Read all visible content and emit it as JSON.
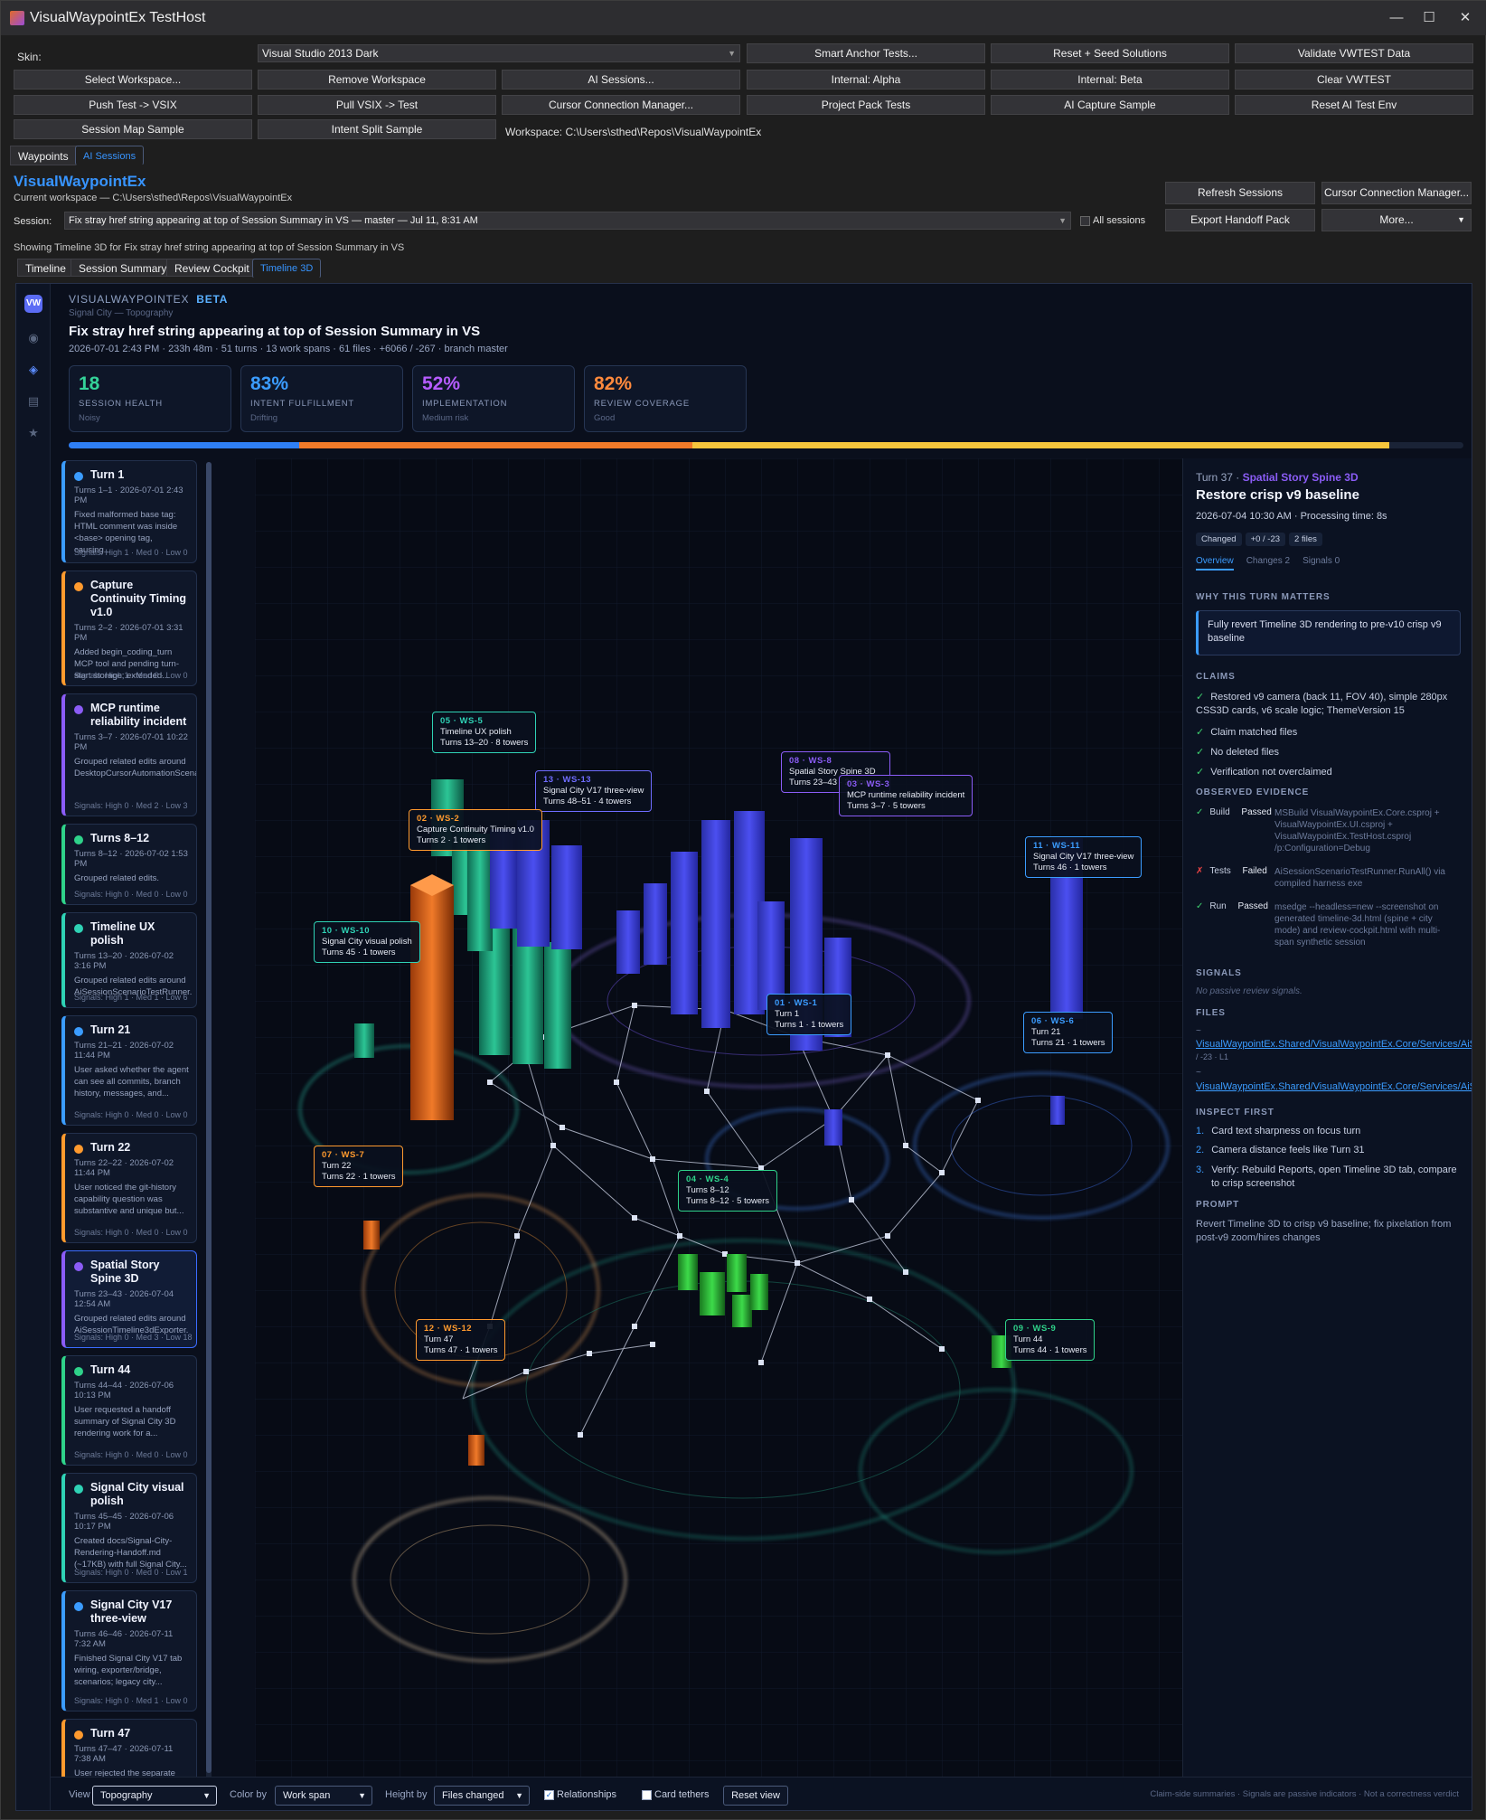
{
  "window": {
    "title": "VisualWaypointEx TestHost",
    "controls": [
      "—",
      "☐",
      "✕"
    ]
  },
  "toolbar": {
    "skin_label": "Skin:",
    "skin_value": "Visual Studio 2013 Dark",
    "buttons": [
      "Smart Anchor Tests...",
      "Reset + Seed Solutions",
      "Validate VWTEST Data",
      "Select Workspace...",
      "Remove Workspace",
      "AI Sessions...",
      "Internal: Alpha",
      "Internal: Beta",
      "Clear VWTEST",
      "Push Test -> VSIX",
      "Pull VSIX -> Test",
      "Cursor Connection Manager...",
      "Project Pack Tests",
      "AI Capture Sample",
      "Reset AI Test Env",
      "Session Map Sample",
      "Intent Split Sample"
    ],
    "workspace_text": "Workspace: C:\\Users\\sthed\\Repos\\VisualWaypointEx"
  },
  "outer_tabs": [
    "Waypoints",
    "AI Sessions"
  ],
  "header": {
    "title": "VisualWaypointEx",
    "workspace": "Current workspace — C:\\Users\\sthed\\Repos\\VisualWaypointEx",
    "session_label": "Session:",
    "session_value": "Fix stray href string appearing at top of Session Summary in VS — master — Jul 11, 8:31 AM",
    "all_sessions": "All sessions",
    "buttons": [
      "Refresh Sessions",
      "Cursor Connection Manager...",
      "Export Handoff Pack",
      "More..."
    ],
    "showing": "Showing Timeline 3D for Fix stray href string appearing at top of Session Summary in VS"
  },
  "inner_tabs": [
    "Timeline",
    "Session Summary",
    "Review Cockpit",
    "Timeline 3D"
  ],
  "report": {
    "rail_icons": [
      "vw-logo-icon",
      "target-icon",
      "diamond-icon",
      "list-icon",
      "star-icon"
    ],
    "logo_text": "VW",
    "brand": "VISUALWAYPOINTEX",
    "beta": "BETA",
    "subtitle": "Signal City — Topography",
    "title": "Fix stray href string appearing at top of Session Summary in VS",
    "meta": "2026-07-01 2:43 PM · 233h 48m · 51 turns · 13 work spans · 61 files · +6066 / -267 · branch master",
    "kpis": [
      {
        "value": "18",
        "label": "SESSION HEALTH",
        "sub": "Noisy",
        "color": "#34d399"
      },
      {
        "value": "83%",
        "label": "INTENT FULFILLMENT",
        "sub": "Drifting",
        "color": "#3b9cff"
      },
      {
        "value": "52%",
        "label": "IMPLEMENTATION",
        "sub": "Medium risk",
        "color": "#b65cff"
      },
      {
        "value": "82%",
        "label": "REVIEW COVERAGE",
        "sub": "Good",
        "color": "#ff8a3d"
      }
    ],
    "progress_segments": [
      {
        "fraction": 0.165,
        "color": "#2f7ff5"
      },
      {
        "fraction": 0.282,
        "color": "#f07a29"
      },
      {
        "fraction": 0.5,
        "color": "#f6c53c"
      }
    ]
  },
  "turn_cards": [
    {
      "title": "Turn 1",
      "meta": "Turns 1–1 · 2026-07-01 2:43 PM",
      "desc": "Fixed malformed base tag: HTML comment was inside <base> opening tag, causing...",
      "signals": "Signals: High 1 · Med 0 · Low 0",
      "color": "#3b9cff"
    },
    {
      "title": "Capture Continuity Timing v1.0",
      "meta": "Turns 2–2 · 2026-07-01 3:31 PM",
      "desc": "Added begin_coding_turn MCP tool and pending turn-start storage; extended...",
      "signals": "Signals: High 1 · Med 0 · Low 0",
      "color": "#ff9a2e"
    },
    {
      "title": "MCP runtime reliability incident",
      "meta": "Turns 3–7 · 2026-07-01 10:22 PM",
      "desc": "Grouped related edits around DesktopCursorAutomationScenarioRunner.",
      "signals": "Signals: High 0 · Med 2 · Low 3",
      "color": "#8b5cf6"
    },
    {
      "title": "Turns 8–12",
      "meta": "Turns 8–12 · 2026-07-02 1:53 PM",
      "desc": "Grouped related edits.",
      "signals": "Signals: High 0 · Med 0 · Low 0",
      "color": "#2fd28a"
    },
    {
      "title": "Timeline UX polish",
      "meta": "Turns 13–20 · 2026-07-02 3:16 PM",
      "desc": "Grouped related edits around AiSessionScenarioTestRunner.",
      "signals": "Signals: High 1 · Med 1 · Low 6",
      "color": "#2fd2b5"
    },
    {
      "title": "Turn 21",
      "meta": "Turns 21–21 · 2026-07-02 11:44 PM",
      "desc": "User asked whether the agent can see all commits, branch history, messages, and...",
      "signals": "Signals: High 0 · Med 0 · Low 0",
      "color": "#3b9cff"
    },
    {
      "title": "Turn 22",
      "meta": "Turns 22–22 · 2026-07-02 11:44 PM",
      "desc": "User noticed the git-history capability question was substantive and unique but...",
      "signals": "Signals: High 0 · Med 0 · Low 0",
      "color": "#ff9a2e"
    },
    {
      "title": "Spatial Story Spine 3D",
      "meta": "Turns 23–43 · 2026-07-04 12:54 AM",
      "desc": "Grouped related edits around AiSessionTimeline3dExporter.",
      "signals": "Signals: High 0 · Med 3 · Low 18",
      "color": "#8b5cf6"
    },
    {
      "title": "Turn 44",
      "meta": "Turns 44–44 · 2026-07-06 10:13 PM",
      "desc": "User requested a handoff summary of Signal City 3D rendering work for a...",
      "signals": "Signals: High 0 · Med 0 · Low 0",
      "color": "#2fd28a"
    },
    {
      "title": "Signal City visual polish",
      "meta": "Turns 45–45 · 2026-07-06 10:17 PM",
      "desc": "Created docs/Signal-City-Rendering-Handoff.md (~17KB) with full Signal City...",
      "signals": "Signals: High 0 · Med 0 · Low 1",
      "color": "#2fd2b5"
    },
    {
      "title": "Signal City V17 three-view",
      "meta": "Turns 46–46 · 2026-07-11 7:32 AM",
      "desc": "Finished Signal City V17 tab wiring, exporter/bridge, scenarios; legacy city...",
      "signals": "Signals: High 0 · Med 1 · Low 0",
      "color": "#3b9cff"
    },
    {
      "title": "Turn 47",
      "meta": "Turns 47–47 · 2026-07-11 7:38 AM",
      "desc": "User rejected the separate Signal City tab. Correct integration is:",
      "signals": "",
      "color": "#ff9a2e"
    }
  ],
  "scene_tags": [
    {
      "id": "05 · WS-5",
      "name": "Timeline UX polish",
      "info": "Turns 13–20 · 8 towers",
      "color": "#2fd2b5"
    },
    {
      "id": "13 · WS-13",
      "name": "Signal City V17 three-view",
      "info": "Turns 48–51 · 4 towers",
      "color": "#6f6cff"
    },
    {
      "id": "08 · WS-8",
      "name": "Spatial Story Spine 3D",
      "info": "Turns 23–43 · 21 towers",
      "color": "#8b5cf6"
    },
    {
      "id": "03 · WS-3",
      "name": "MCP runtime reliability incident",
      "info": "Turns 3–7 · 5 towers",
      "color": "#8b5cf6"
    },
    {
      "id": "02 · WS-2",
      "name": "Capture Continuity Timing v1.0",
      "info": "Turns 2 · 1 towers",
      "color": "#ff9a2e"
    },
    {
      "id": "11 · WS-11",
      "name": "Signal City V17 three-view",
      "info": "Turns 46 · 1 towers",
      "color": "#3b9cff"
    },
    {
      "id": "10 · WS-10",
      "name": "Signal City visual polish",
      "info": "Turns 45 · 1 towers",
      "color": "#2fd2b5"
    },
    {
      "id": "01 · WS-1",
      "name": "Turn 1",
      "info": "Turns 1 · 1 towers",
      "color": "#3b9cff"
    },
    {
      "id": "06 · WS-6",
      "name": "Turn 21",
      "info": "Turns 21 · 1 towers",
      "color": "#3b9cff"
    },
    {
      "id": "07 · WS-7",
      "name": "Turn 22",
      "info": "Turns 22 · 1 towers",
      "color": "#ff9a2e"
    },
    {
      "id": "04 · WS-4",
      "name": "Turns 8–12",
      "info": "Turns 8–12 · 5 towers",
      "color": "#2fd28a"
    },
    {
      "id": "09 · WS-9",
      "name": "Turn 44",
      "info": "Turns 44 · 1 towers",
      "color": "#2fd28a"
    },
    {
      "id": "12 · WS-12",
      "name": "Turn 47",
      "info": "Turns 47 · 1 towers",
      "color": "#ff9a2e"
    }
  ],
  "detail": {
    "turn": "Turn 37 ·",
    "span": "Spatial Story Spine 3D",
    "title": "Restore crisp v9 baseline",
    "time": "2026-07-04 10:30 AM · Processing time: 8s",
    "pills": [
      "Changed",
      "+0 / -23",
      "2 files"
    ],
    "tabs": [
      "Overview",
      "Changes 2",
      "Signals 0"
    ],
    "why_label": "WHY THIS TURN MATTERS",
    "why": "Fully revert Timeline 3D rendering to pre-v10 crisp v9 baseline",
    "claims_label": "CLAIMS",
    "claims": [
      "Restored v9 camera (back 11, FOV 40), simple 280px CSS3D cards, v6 scale logic; ThemeVersion 15",
      "Claim matched files",
      "No deleted files",
      "Verification not overclaimed"
    ],
    "evidence_label": "OBSERVED EVIDENCE",
    "evidence": [
      {
        "mark": "✓",
        "kind": "Build",
        "status": "Passed",
        "detail": "MSBuild VisualWaypointEx.Core.csproj + VisualWaypointEx.UI.csproj + VisualWaypointEx.TestHost.csproj /p:Configuration=Debug"
      },
      {
        "mark": "✗",
        "kind": "Tests",
        "status": "Failed",
        "detail": "AiSessionScenarioTestRunner.RunAll() via compiled harness exe"
      },
      {
        "mark": "✓",
        "kind": "Run",
        "status": "Passed",
        "detail": "msedge --headless=new --screenshot on generated timeline-3d.html (spine + city mode) and review-cockpit.html with multi-span synthetic session"
      }
    ],
    "signals_label": "SIGNALS",
    "signals_text": "No passive review signals.",
    "files_label": "FILES",
    "files": [
      "~",
      "VisualWaypointEx.Shared/VisualWaypointEx.Core/Services/AiSe",
      "/ -23 · L1",
      "~",
      "VisualWaypointEx.Shared/VisualWaypointEx.Core/Services/AiSe"
    ],
    "inspect_label": "INSPECT FIRST",
    "inspect": [
      "Card text sharpness on focus turn",
      "Camera distance feels like Turn 31",
      "Verify: Rebuild Reports, open Timeline 3D tab, compare to crisp screenshot"
    ],
    "prompt_label": "PROMPT",
    "prompt": "Revert Timeline 3D to crisp v9 baseline; fix pixelation from post-v9 zoom/hires changes"
  },
  "footer": {
    "view_label": "View",
    "view_value": "Topography",
    "color_label": "Color by",
    "color_value": "Work span",
    "height_label": "Height by",
    "height_value": "Files changed",
    "relationships": "Relationships",
    "card_tethers": "Card tethers",
    "reset": "Reset view",
    "note": "Claim-side summaries · Signals are passive indicators · Not a correctness verdict"
  }
}
